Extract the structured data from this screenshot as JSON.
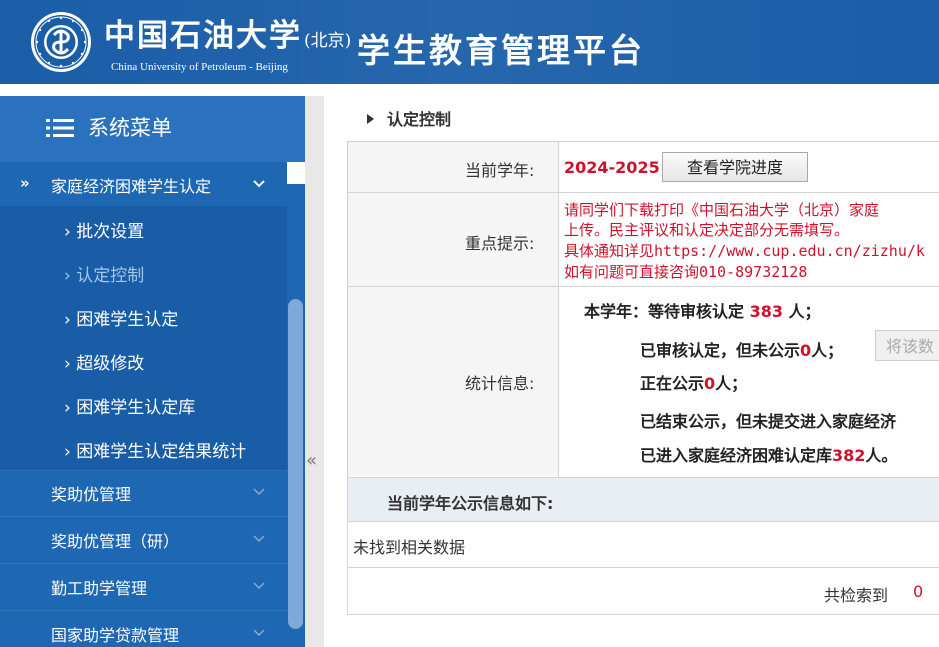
{
  "header": {
    "logo_cn": "中国石油大学",
    "logo_cn_sub": "(北京)",
    "logo_en": "China University of Petroleum - Beijing",
    "platform_title": "学生教育管理平台",
    "bg_color": "#1a5ea8"
  },
  "sidebar": {
    "menu_title": "系统菜单",
    "group_open": {
      "prefix": "»",
      "label": "家庭经济困难学生认定"
    },
    "sub_items": [
      {
        "label": "› 批次设置"
      },
      {
        "label": "› 认定控制",
        "active": true
      },
      {
        "label": "› 困难学生认定"
      },
      {
        "label": "› 超级修改"
      },
      {
        "label": "› 困难学生认定库"
      },
      {
        "label": "› 困难学生认定结果统计"
      }
    ],
    "groups": [
      {
        "label": "奖助优管理"
      },
      {
        "label": "奖助优管理（研）"
      },
      {
        "label": "勤工助学管理"
      },
      {
        "label": "国家助学贷款管理"
      }
    ],
    "collapse_label": "«"
  },
  "main": {
    "breadcrumb": "认定控制",
    "form": {
      "year_label": "当前学年:",
      "year_value": "2024-2025",
      "progress_button": "查看学院进度",
      "notice_label": "重点提示:",
      "notice_lines": [
        "请同学们下载打印《中国石油大学（北京）家庭",
        "上传。民主评议和认定决定部分无需填写。",
        "具体通知详见https://www.cup.edu.cn/zizhu/k",
        "如有问题可直接咨询010-89732128"
      ],
      "stats_label": "统计信息:",
      "stats": {
        "line1_prefix": "本学年：等待审核认定 ",
        "line1_num": "383",
        "line1_suffix": " 人；",
        "line2_prefix": "已审核认定，但未公示",
        "line2_num": "0",
        "line2_suffix": "人；",
        "publish_button": "将该数",
        "line3_prefix": "正在公示",
        "line3_num": "0",
        "line3_suffix": "人；",
        "line4": "已结束公示，但未提交进入家庭经济",
        "line5_prefix": "已进入家庭经济困难认定库",
        "line5_num": "382",
        "line5_suffix": "人。"
      }
    },
    "publicity": {
      "header": "当前学年公示信息如下:",
      "empty_text": "未找到相关数据",
      "total_label": "共检索到",
      "total_value": "0"
    }
  }
}
